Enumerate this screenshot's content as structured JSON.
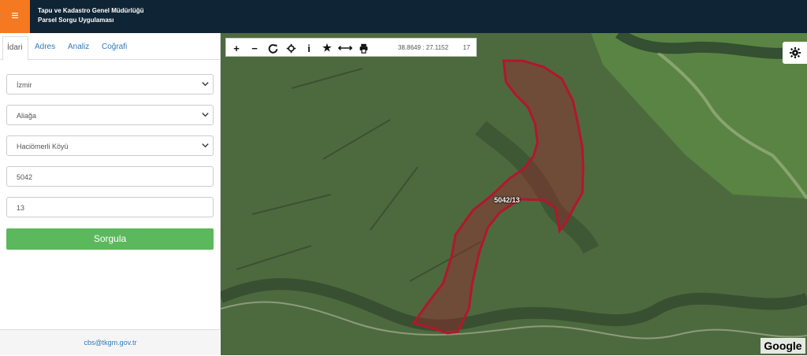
{
  "header": {
    "title_line1": "Tapu ve Kadastro Genel Müdürlüğü",
    "title_line2": "Parsel Sorgu Uygulaması",
    "menu_glyph": "≡"
  },
  "tabs": [
    {
      "label": "İdari"
    },
    {
      "label": "Adres"
    },
    {
      "label": "Analiz"
    },
    {
      "label": "Coğrafi"
    }
  ],
  "form": {
    "province": "İzmir",
    "district": "Aliağa",
    "neighborhood": "Haciömerli Köyü",
    "block": "5042",
    "parcel": "13",
    "submit_label": "Sorgula"
  },
  "footer": {
    "email": "cbs@tkgm.gov.tr"
  },
  "map": {
    "coordinates": "38.8649 : 27.1152",
    "zoom_level": "17",
    "parcel_label": "5042/13",
    "google_label": "Google",
    "tool_icons": [
      "zoom-in-icon",
      "zoom-out-icon",
      "refresh-icon",
      "locate-icon",
      "info-icon",
      "star-icon",
      "measure-icon",
      "print-icon"
    ],
    "tool_glyphs": {
      "zoom_in": "+",
      "zoom_out": "−",
      "info": "i",
      "star": "★",
      "measure": "⟷"
    }
  },
  "colors": {
    "header": "#0f2435",
    "menu_button": "#f47920",
    "submit_button": "#5cb85c",
    "parcel_outline": "#a61d2d"
  }
}
